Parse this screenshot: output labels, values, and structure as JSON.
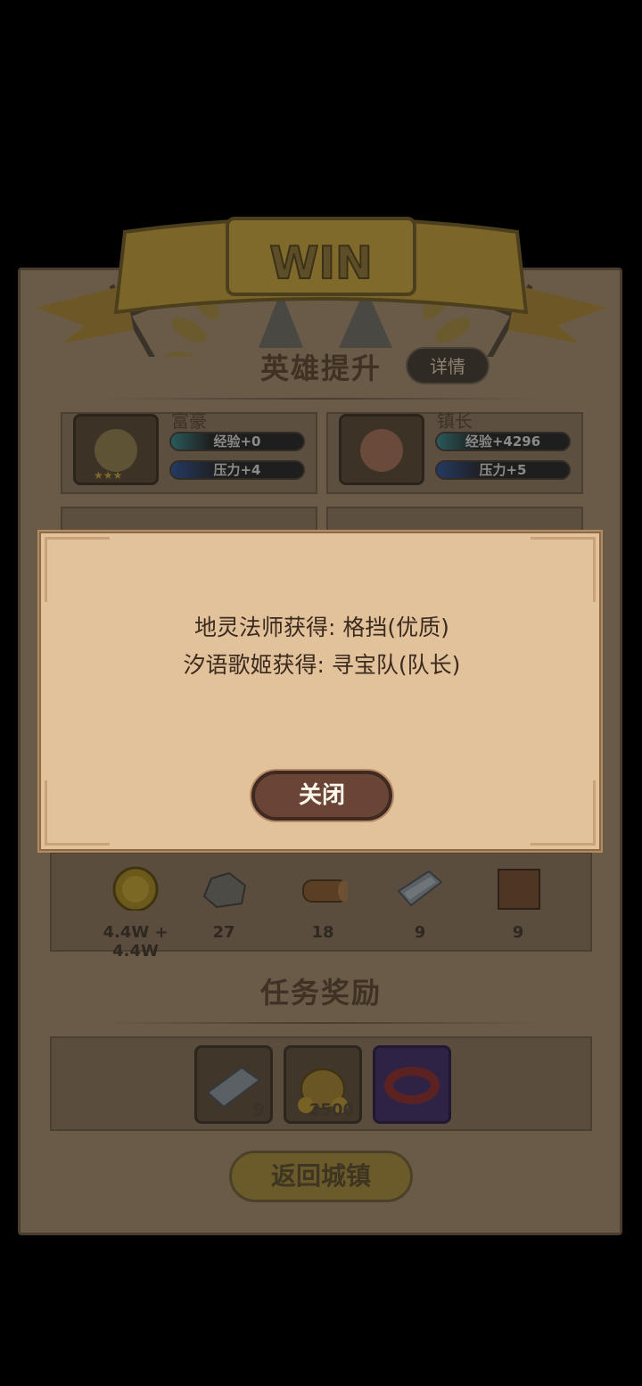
{
  "banner": {
    "title": "WIN"
  },
  "hero_section": {
    "title": "英雄提升",
    "detail_label": "详情",
    "heroes": [
      {
        "name": "富豪",
        "exp": "经验+0",
        "pressure": "压力+4"
      },
      {
        "name": "镇长",
        "exp": "经验+4296",
        "pressure": "压力+5"
      }
    ]
  },
  "rewards": [
    {
      "icon": "gold-coin-icon",
      "count": "4.4W + 4.4W"
    },
    {
      "icon": "stone-icon",
      "count": "27"
    },
    {
      "icon": "wood-log-icon",
      "count": "18"
    },
    {
      "icon": "iron-plate-icon",
      "count": "9"
    },
    {
      "icon": "leather-icon",
      "count": "9"
    }
  ],
  "task_section": {
    "title": "任务奖励",
    "items": [
      {
        "icon": "iron-plate-icon",
        "count": "9"
      },
      {
        "icon": "money-bag-icon",
        "count": "2500"
      },
      {
        "icon": "red-belt-icon",
        "count": ""
      }
    ]
  },
  "return_button": "返回城镇",
  "popup": {
    "line1": "地灵法师获得: 格挡(优质)",
    "line2": "汐语歌姬获得: 寻宝队(队长)",
    "close_label": "关闭"
  },
  "colors": {
    "popup_bg": "#e2c29b",
    "close_button": "#6a4536",
    "panel_bg_dimmed": "#6a5b48"
  }
}
